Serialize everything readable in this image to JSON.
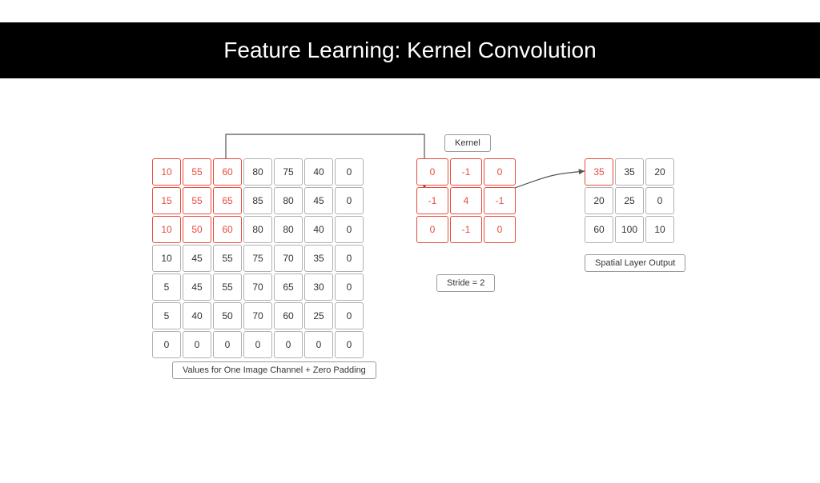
{
  "title": "Feature Learning: Kernel Convolution",
  "labels": {
    "kernel": "Kernel",
    "stride": "Stride = 2",
    "input": "Values for One Image Channel + Zero Padding",
    "output": "Spatial Layer Output"
  },
  "input": {
    "rows": [
      [
        10,
        55,
        60,
        80,
        75,
        40,
        0
      ],
      [
        15,
        55,
        65,
        85,
        80,
        45,
        0
      ],
      [
        10,
        50,
        60,
        80,
        80,
        40,
        0
      ],
      [
        10,
        45,
        55,
        75,
        70,
        35,
        0
      ],
      [
        5,
        45,
        55,
        70,
        65,
        30,
        0
      ],
      [
        5,
        40,
        50,
        70,
        60,
        25,
        0
      ],
      [
        0,
        0,
        0,
        0,
        0,
        0,
        0
      ]
    ],
    "highlight": {
      "r0": 0,
      "c0": 0,
      "r1": 2,
      "c1": 2
    }
  },
  "kernel": {
    "rows": [
      [
        0,
        -1,
        0
      ],
      [
        -1,
        4,
        -1
      ],
      [
        0,
        -1,
        0
      ]
    ]
  },
  "output": {
    "rows": [
      [
        35,
        35,
        20
      ],
      [
        20,
        25,
        0
      ],
      [
        60,
        100,
        10
      ]
    ],
    "highlight": {
      "r": 0,
      "c": 0
    }
  }
}
